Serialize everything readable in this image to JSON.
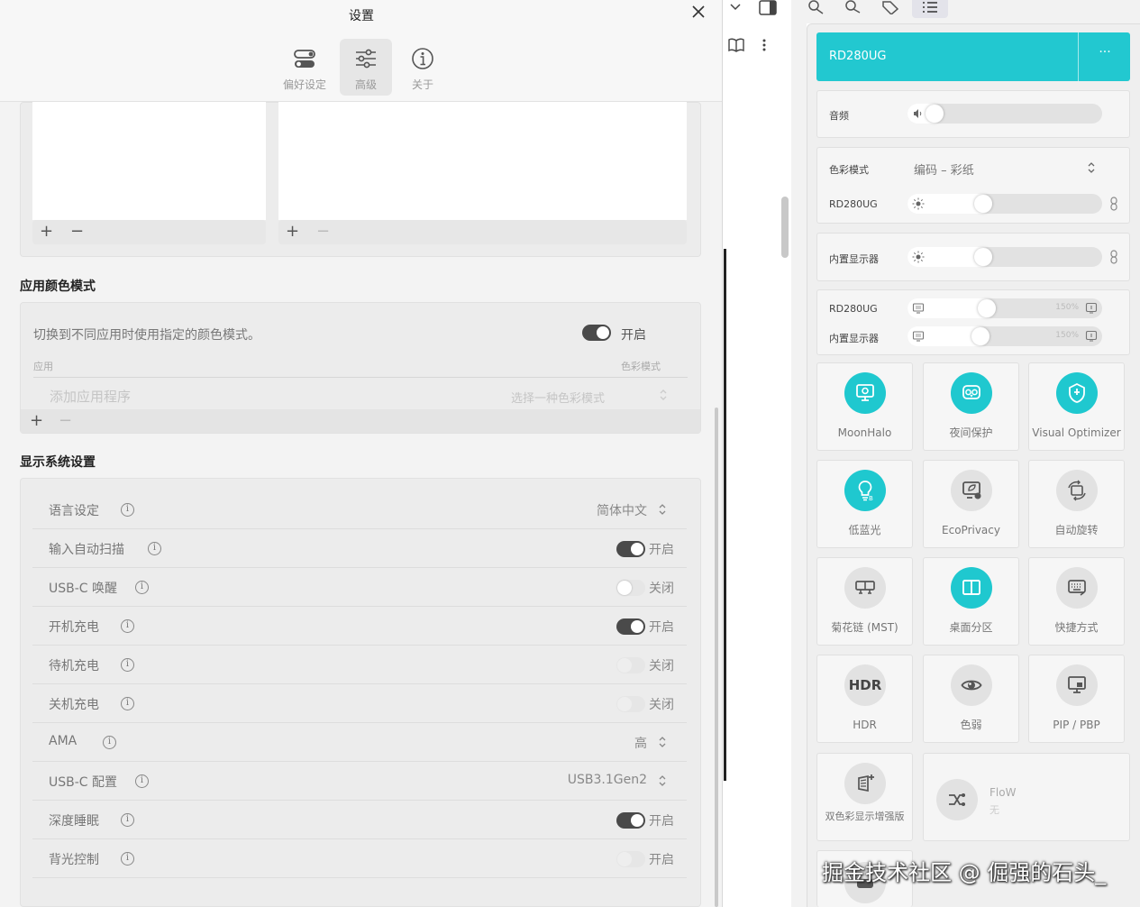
{
  "settings": {
    "title": "设置",
    "tabs": [
      {
        "label": "偏好设定",
        "active": false
      },
      {
        "label": "高级",
        "active": true
      },
      {
        "label": "关于",
        "active": false
      }
    ],
    "list_buttons": {
      "add": "+",
      "remove": "−"
    },
    "app_color_mode": {
      "title": "应用颜色模式",
      "description": "切换到不同应用时使用指定的颜色模式。",
      "toggle_label": "开启",
      "toggle_on": true,
      "col_app": "应用",
      "col_mode": "色彩模式",
      "app_placeholder": "添加应用程序",
      "mode_placeholder": "选择一种色彩模式"
    },
    "display_system": {
      "title": "显示系统设置",
      "rows": [
        {
          "label": "语言设定",
          "type": "select",
          "value": "简体中文"
        },
        {
          "label": "输入自动扫描",
          "type": "toggle",
          "state": "on",
          "value": "开启"
        },
        {
          "label": "USB-C 唤醒",
          "type": "toggle",
          "state": "off",
          "value": "关闭"
        },
        {
          "label": "开机充电",
          "type": "toggle",
          "state": "on",
          "value": "开启"
        },
        {
          "label": "待机充电",
          "type": "toggle",
          "state": "disabled",
          "value": "关闭"
        },
        {
          "label": "关机充电",
          "type": "toggle",
          "state": "disabled",
          "value": "关闭"
        },
        {
          "label": "AMA",
          "type": "select",
          "value": "高"
        },
        {
          "label": "USB-C 配置",
          "type": "select",
          "value": "USB3.1Gen2"
        },
        {
          "label": "深度睡眠",
          "type": "toggle",
          "state": "on",
          "value": "开启"
        },
        {
          "label": "背光控制",
          "type": "toggle",
          "state": "disabled",
          "value": "开启"
        }
      ]
    }
  },
  "panel": {
    "device_name": "RD280UG",
    "more_label": "···",
    "audio_label": "音频",
    "audio_level": 0.0,
    "color_mode_label": "色彩模式",
    "color_mode_value": "编码 – 彩纸",
    "brightness": [
      {
        "label": "RD280UG",
        "level": 0.38
      },
      {
        "label": "内置显示器",
        "level": 0.38
      }
    ],
    "scaling": [
      {
        "label": "RD280UG",
        "value": "150%",
        "level": 0.4
      },
      {
        "label": "内置显示器",
        "value": "150%",
        "level": 0.36
      }
    ],
    "tiles": [
      {
        "label": "MoonHalo",
        "icon": "monitor-light-icon",
        "on": true
      },
      {
        "label": "夜间保护",
        "icon": "owl-icon",
        "on": true
      },
      {
        "label": "Visual Optimizer",
        "icon": "shield-icon",
        "on": true
      },
      {
        "label": "低蓝光",
        "icon": "bulb-icon",
        "on": true
      },
      {
        "label": "EcoPrivacy",
        "icon": "eco-monitor-icon",
        "on": false
      },
      {
        "label": "自动旋转",
        "icon": "rotate-icon",
        "on": false
      },
      {
        "label": "菊花链 (MST)",
        "icon": "daisy-chain-icon",
        "on": false
      },
      {
        "label": "桌面分区",
        "icon": "split-screen-icon",
        "on": true
      },
      {
        "label": "快捷方式",
        "icon": "keyboard-icon",
        "on": false
      },
      {
        "label": "HDR",
        "icon": "hdr-icon",
        "on": false
      },
      {
        "label": "色弱",
        "icon": "eye-icon",
        "on": false
      },
      {
        "label": "PIP / PBP",
        "icon": "pip-icon",
        "on": false
      },
      {
        "label": "双色彩显示增强版",
        "icon": "dual-color-icon",
        "on": false
      }
    ],
    "hdr_glyph": "HDR",
    "flow": {
      "label": "FloW",
      "sub": "无"
    }
  },
  "watermark": "掘金技术社区 @ 倔强的石头_"
}
